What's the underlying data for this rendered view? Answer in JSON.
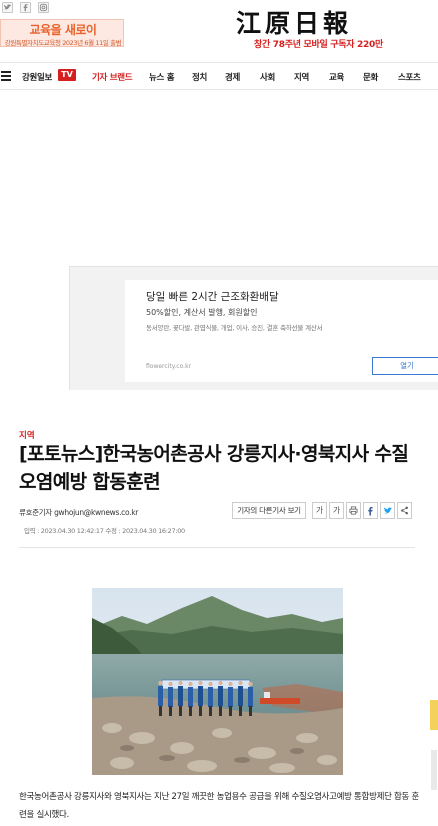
{
  "topbar": {
    "sns": [
      "twitter-icon",
      "facebook-icon",
      "instagram-icon"
    ],
    "banner": {
      "main_text": "교육을 새로이",
      "sub_text": "강원특별자치도교육청 2023년 6월 11일 출범"
    },
    "logo_text": "江原日報",
    "slogan": "창간 78주년 모바일 구독자 220만"
  },
  "nav": {
    "brand": "강원일보",
    "tv_badge": "TV",
    "items": [
      "기자 브랜드",
      "뉴스 홈",
      "정치",
      "경제",
      "사회",
      "지역",
      "교육",
      "문화",
      "스포츠"
    ]
  },
  "ad": {
    "title": "당일 빠른 2시간 근조화환배달",
    "subtitle": "50%할인, 계산서 발행, 회원할인",
    "description": "동서양란, 꽃다발, 관엽식물, 개업, 이사, 승진, 결혼 축하선물 계산서",
    "domain": "flowercity.co.kr",
    "button_label": "열기"
  },
  "article": {
    "section": "지역",
    "headline": "[포토뉴스]한국농어촌공사 강릉지사·영북지사 수질오염예방 합동훈련",
    "byline": "류호준기자 gwhojun@kwnews.co.kr",
    "more_button": "기자의 다른기사 보기",
    "tools": [
      "가",
      "가",
      "print-icon",
      "facebook-icon",
      "twitter-icon",
      "share-icon"
    ],
    "dates": "입력 : 2023.04.30 12:42:17 수정 : 2023.04.30 16:27:00",
    "body_text": "한국농어촌공사 강릉지사와 영북지사는 지난 27일 깨끗한 농업용수 공급을 위해 수질오염사고예방 통합방제단 합동 훈련을 실시했다."
  },
  "colors": {
    "accent": "#d62020",
    "link_blue": "#3b7bd3",
    "banner_orange": "#e8622c"
  }
}
